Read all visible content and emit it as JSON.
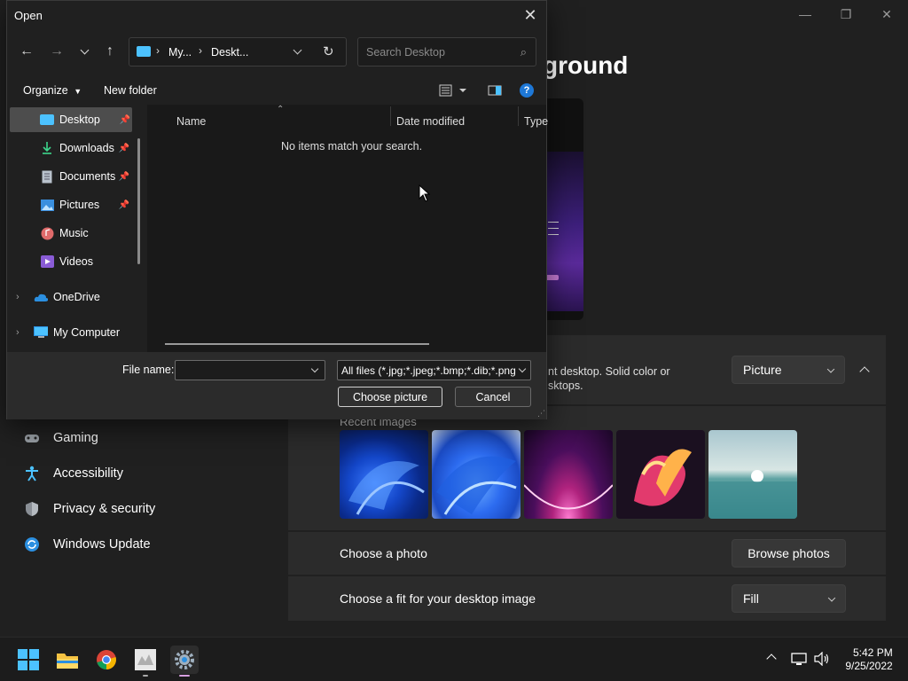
{
  "settings": {
    "page_title_partial": "ground",
    "window_controls": {
      "minimize": "—",
      "maximize": "❐",
      "close": "✕"
    },
    "background_card": {
      "description_line1": "nt desktop. Solid color or",
      "description_line2": "sktops.",
      "dropdown_value": "Picture"
    },
    "recent_images_label": "Recent images",
    "choose_photo": {
      "label": "Choose a photo",
      "button": "Browse photos"
    },
    "choose_fit": {
      "label": "Choose a fit for your desktop image",
      "dropdown_value": "Fill"
    },
    "nav_items": [
      {
        "label": "Gaming",
        "icon": "gamepad-icon"
      },
      {
        "label": "Accessibility",
        "icon": "accessibility-icon"
      },
      {
        "label": "Privacy & security",
        "icon": "shield-icon"
      },
      {
        "label": "Windows Update",
        "icon": "update-icon"
      }
    ]
  },
  "dialog": {
    "title": "Open",
    "address": {
      "segment1": "My...",
      "segment2": "Deskt..."
    },
    "search_placeholder": "Search Desktop",
    "toolbar": {
      "organize": "Organize",
      "new_folder": "New folder"
    },
    "nav_pane": [
      {
        "label": "Desktop",
        "pinned": true,
        "selected": true
      },
      {
        "label": "Downloads",
        "pinned": true
      },
      {
        "label": "Documents",
        "pinned": true
      },
      {
        "label": "Pictures",
        "pinned": true
      },
      {
        "label": "Music",
        "pinned": false
      },
      {
        "label": "Videos",
        "pinned": false
      },
      {
        "label": "OneDrive",
        "pinned": false
      },
      {
        "label": "My Computer",
        "pinned": false
      }
    ],
    "columns": {
      "name": "Name",
      "date_modified": "Date modified",
      "type": "Type"
    },
    "empty_message": "No items match your search.",
    "file_name_label": "File name:",
    "file_name_value": "",
    "file_type_filter": "All files (*.jpg;*.jpeg;*.bmp;*.dib;*.png",
    "choose_button": "Choose picture",
    "cancel_button": "Cancel"
  },
  "taskbar": {
    "time": "5:42 PM",
    "date": "9/25/2022"
  },
  "colors": {
    "accent": "#4cc2ff",
    "dialog_bg": "#202020",
    "card_bg": "#2b2b2b"
  }
}
